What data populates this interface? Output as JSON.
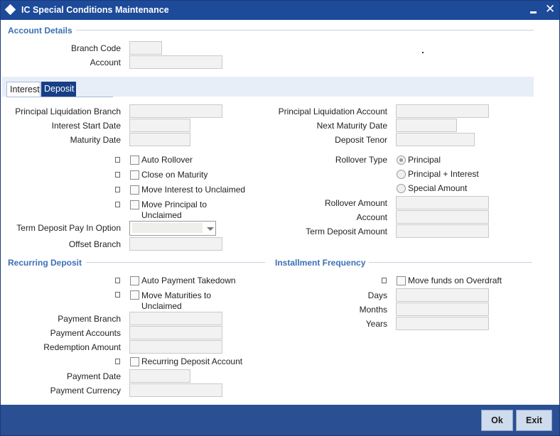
{
  "window": {
    "title": "IC Special Conditions Maintenance"
  },
  "account_details": {
    "section_title": "Account Details",
    "branch_code_label": "Branch Code",
    "branch_code_value": "",
    "account_label": "Account",
    "account_value": ""
  },
  "tabs": [
    {
      "label": "Interest",
      "active": false
    },
    {
      "label": "Deposit",
      "active": true
    }
  ],
  "deposit": {
    "principal_liquidation_branch": "Principal Liquidation Branch",
    "interest_start_date": "Interest Start Date",
    "maturity_date": "Maturity Date",
    "principal_liquidation_account": "Principal Liquidation Account",
    "next_maturity_date": "Next Maturity Date",
    "deposit_tenor": "Deposit Tenor",
    "auto_rollover": "Auto Rollover",
    "close_on_maturity": "Close on Maturity",
    "move_interest_unclaimed": "Move Interest to Unclaimed",
    "move_principal_line1": "Move Principal to",
    "move_principal_line2": "Unclaimed",
    "rollover_type": "Rollover Type",
    "rollover_options": [
      "Principal",
      "Principal + Interest",
      "Special Amount"
    ],
    "rollover_selected": "Principal",
    "rollover_amount": "Rollover Amount",
    "account": "Account",
    "term_deposit_amount": "Term Deposit Amount",
    "term_deposit_pay_in_option": "Term Deposit Pay In Option",
    "term_deposit_pay_in_value": "",
    "offset_branch": "Offset Branch"
  },
  "recurring_deposit": {
    "section_title": "Recurring Deposit",
    "auto_payment_takedown": "Auto Payment Takedown",
    "move_maturities_line1": "Move Maturities to",
    "move_maturities_line2": "Unclaimed",
    "payment_branch": "Payment Branch",
    "payment_accounts": "Payment Accounts",
    "redemption_amount": "Redemption Amount",
    "recurring_deposit_account": "Recurring Deposit Account",
    "payment_date": "Payment Date",
    "payment_currency": "Payment Currency"
  },
  "installment_frequency": {
    "section_title": "Installment Frequency",
    "move_funds_on_overdraft": "Move funds on Overdraft",
    "days": "Days",
    "months": "Months",
    "years": "Years"
  },
  "footer": {
    "ok_label": "Ok",
    "exit_label": "Exit"
  },
  "colors": {
    "titlebar": "#1d4a99",
    "section_title": "#3b6fb6",
    "footer": "#2a4f93",
    "active_tab": "#163f87"
  },
  "icons": [
    "diamond-app-icon",
    "minimize-icon",
    "close-icon",
    "chevron-down-icon"
  ]
}
